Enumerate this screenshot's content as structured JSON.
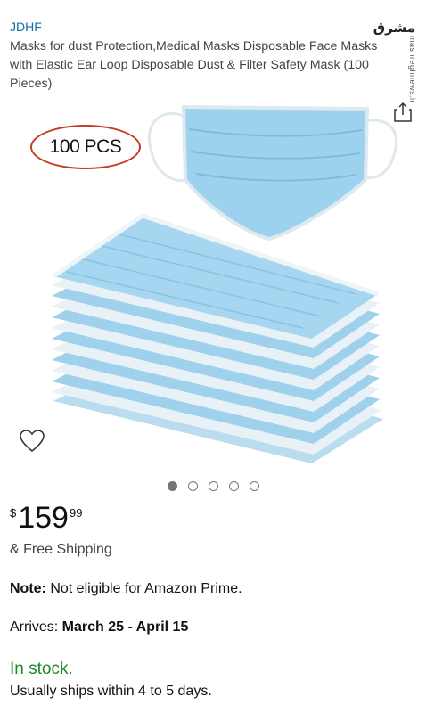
{
  "product": {
    "brand": "JDHF",
    "title": "Masks for dust Protection,Medical Masks Disposable Face Masks with Elastic Ear Loop Disposable Dust & Filter Safety Mask (100 Pieces)",
    "image_badge": "100 PCS"
  },
  "watermark": {
    "logo": "مشرق",
    "text": "mashreghnews.ir"
  },
  "gallery": {
    "dot_count": 5,
    "active_index": 0
  },
  "price": {
    "currency": "$",
    "whole": "159",
    "fraction": "99"
  },
  "shipping": "& Free Shipping",
  "note": {
    "label": "Note:",
    "text": " Not eligible for Amazon Prime."
  },
  "arrives": {
    "label": "Arrives: ",
    "dates": "March 25 - April 15"
  },
  "stock": "In stock.",
  "ships_within": "Usually ships within 4 to 5 days.",
  "colors": {
    "brand_link": "#0b6ea8",
    "in_stock": "#1e8a2a",
    "badge_border": "#c23c1e",
    "mask_blue": "#8ec9ea"
  },
  "icons": [
    "share-icon",
    "heart-icon"
  ]
}
